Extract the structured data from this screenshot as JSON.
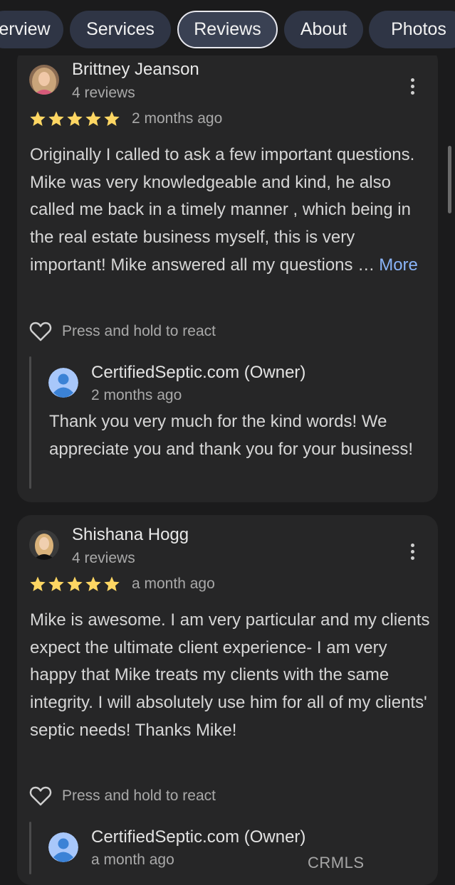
{
  "tabs": [
    {
      "label": "erview",
      "active": false
    },
    {
      "label": "Services",
      "active": false
    },
    {
      "label": "Reviews",
      "active": true
    },
    {
      "label": "About",
      "active": false
    },
    {
      "label": "Photos",
      "active": false
    }
  ],
  "reviews": [
    {
      "reviewer": "Brittney Jeanson",
      "review_count": "4 reviews",
      "rating": 5,
      "time": "2 months ago",
      "text": "Originally I called to ask a few important questions. Mike was very knowledgeable and kind, he also called me back in a timely manner , which being in the real estate business myself, this is very important! Mike answered all my questions …",
      "more_label": "More",
      "react_label": "Press and hold to react",
      "reply": {
        "owner": "CertifiedSeptic.com (Owner)",
        "time": "2 months ago",
        "text": "Thank you very much for the kind words! We appreciate you and thank you for your business!"
      }
    },
    {
      "reviewer": "Shishana Hogg",
      "review_count": "4 reviews",
      "rating": 5,
      "time": "a month ago",
      "text": "Mike is awesome. I am very particular and my clients expect the ultimate client experience- I am very happy that Mike treats my clients with the same integrity. I will absolutely use him for all of my clients' septic needs! Thanks Mike!",
      "react_label": "Press and hold to react",
      "reply": {
        "owner": "CertifiedSeptic.com (Owner)",
        "time": "a month ago"
      }
    }
  ],
  "watermark": "CRMLS",
  "colors": {
    "background": "#1b1b1c",
    "card": "#262627",
    "tab": "#2f3545",
    "star": "#fdd663",
    "link": "#8ab4f8"
  }
}
